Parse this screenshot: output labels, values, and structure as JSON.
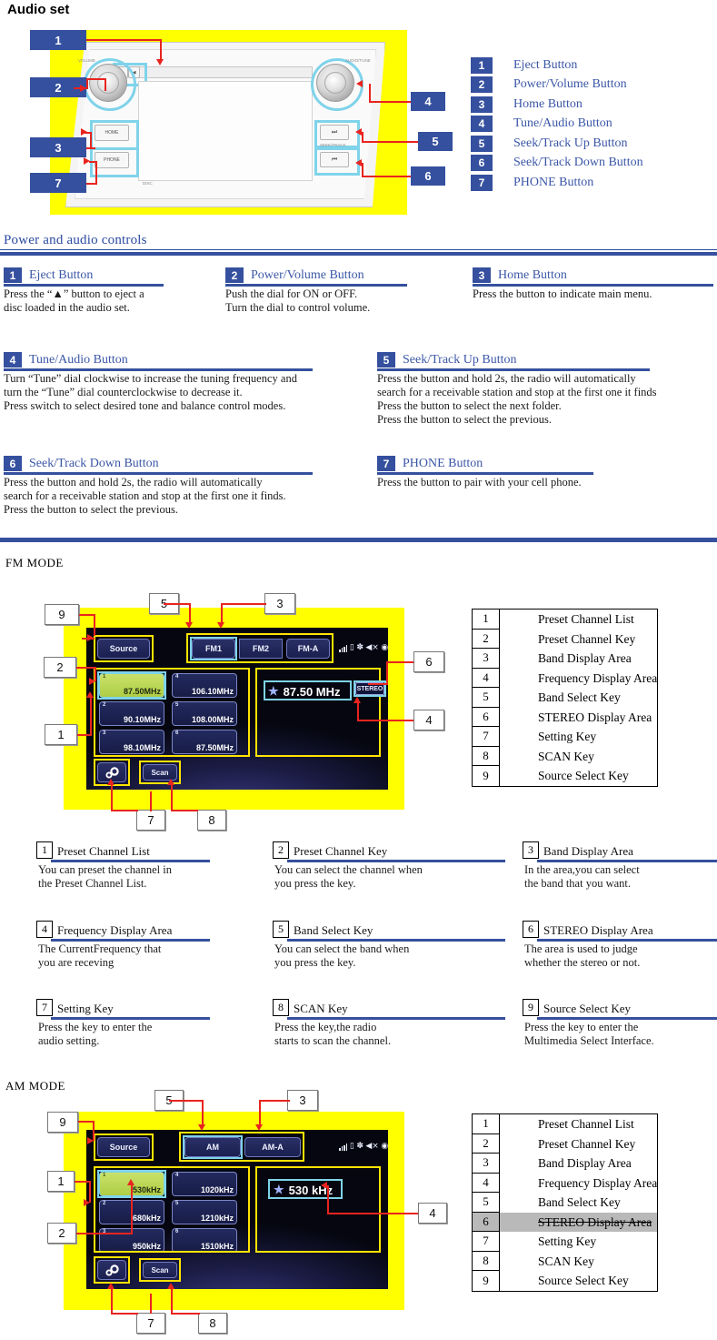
{
  "page_title": "Audio set",
  "head_unit": {
    "knob_left_label": "VOLUME",
    "knob_right_label": "AUDIO/TUNE",
    "key_home": "HOME",
    "key_phone": "PHONE",
    "key_seek_up": "⏭",
    "key_seek_down": "⏮",
    "seek_track_caption": "SEEK/TRACK",
    "disc_caption": "DISC",
    "eject_glyph": "▲",
    "disc_glyph": "◀",
    "callouts": [
      "1",
      "2",
      "3",
      "7",
      "4",
      "5",
      "6"
    ]
  },
  "top_legend": [
    {
      "num": "1",
      "label": "Eject Button"
    },
    {
      "num": "2",
      "label": "Power/Volume Button"
    },
    {
      "num": "3",
      "label": "Home Button"
    },
    {
      "num": "4",
      "label": "Tune/Audio Button"
    },
    {
      "num": "5",
      "label": "Seek/Track Up Button"
    },
    {
      "num": "6",
      "label": "Seek/Track Down Button"
    },
    {
      "num": "7",
      "label": "PHONE Button"
    }
  ],
  "controls_section": {
    "heading": "Power and audio controls",
    "topics": [
      {
        "num": "1",
        "name": "Eject Button",
        "lines": [
          "Press the “▲” button to eject a",
          "disc loaded in the audio set."
        ]
      },
      {
        "num": "2",
        "name": "Power/Volume Button",
        "lines": [
          "Push the dial for ON or OFF.",
          "Turn the dial to control volume."
        ]
      },
      {
        "num": "3",
        "name": "Home Button",
        "lines": [
          "Press the button to indicate main menu."
        ]
      },
      {
        "num": "4",
        "name": "Tune/Audio Button",
        "lines": [
          "Turn “Tune” dial clockwise to increase the tuning frequency and",
          "turn the “Tune” dial counterclockwise to decrease it.",
          "Press switch to select desired tone and balance control modes."
        ]
      },
      {
        "num": "5",
        "name": "Seek/Track Up Button",
        "lines": [
          "Press the button and hold 2s, the radio will automatically",
          "search for a receivable station and stop at the first one it finds",
          "Press the button to select the next folder.",
          "Press the button to select the previous."
        ]
      },
      {
        "num": "6",
        "name": "Seek/Track Down Button",
        "lines": [
          "Press the button and hold 2s, the radio will automatically",
          "search for a receivable station and stop at the first one it finds.",
          "Press the button to select the previous."
        ]
      },
      {
        "num": "7",
        "name": "PHONE Button",
        "lines": [
          "Press the button to pair with your cell phone."
        ]
      }
    ]
  },
  "fm_mode": {
    "label": "FM  MODE",
    "screen": {
      "source_button": "Source",
      "bands": [
        {
          "label": "FM1",
          "active": true
        },
        {
          "label": "FM2",
          "active": false
        },
        {
          "label": "FM-A",
          "active": false
        }
      ],
      "presets": [
        {
          "idx": "1",
          "freq": "87.50MHz",
          "selected": true
        },
        {
          "idx": "2",
          "freq": "90.10MHz",
          "selected": false
        },
        {
          "idx": "3",
          "freq": "98.10MHz",
          "selected": false
        },
        {
          "idx": "4",
          "freq": "106.10MHz",
          "selected": false
        },
        {
          "idx": "5",
          "freq": "108.00MHz",
          "selected": false
        },
        {
          "idx": "6",
          "freq": "87.50MHz",
          "selected": false
        }
      ],
      "current_frequency": "87.50 MHz",
      "stereo_tag": "STEREO",
      "scan_button": "Scan",
      "setting_icon": "gear-icon",
      "star_glyph": "★"
    },
    "callouts": [
      "9",
      "5",
      "3",
      "2",
      "1",
      "6",
      "4",
      "7",
      "8"
    ],
    "legend": [
      {
        "num": "1",
        "label": "Preset Channel List",
        "struck": false
      },
      {
        "num": "2",
        "label": "Preset Channel Key",
        "struck": false
      },
      {
        "num": "3",
        "label": "Band Display Area",
        "struck": false
      },
      {
        "num": "4",
        "label": "Frequency Display Area",
        "struck": false
      },
      {
        "num": "5",
        "label": "Band Select Key",
        "struck": false
      },
      {
        "num": "6",
        "label": "STEREO Display Area",
        "struck": false
      },
      {
        "num": "7",
        "label": "Setting Key",
        "struck": false
      },
      {
        "num": "8",
        "label": "SCAN Key",
        "struck": false
      },
      {
        "num": "9",
        "label": "Source Select Key",
        "struck": false
      }
    ],
    "topics": [
      {
        "num": "1",
        "name": "Preset Channel List",
        "lines": [
          "You can preset the channel in",
          "the Preset Channel List."
        ]
      },
      {
        "num": "2",
        "name": "Preset Channel Key",
        "lines": [
          "You can select the channel when",
          " you press the key."
        ]
      },
      {
        "num": "3",
        "name": "Band Display Area",
        "lines": [
          "In the area,you can select",
          "the band that you want."
        ]
      },
      {
        "num": "4",
        "name": "Frequency Display Area",
        "lines": [
          "The CurrentFrequency that",
          "you are receving"
        ]
      },
      {
        "num": "5",
        "name": "Band Select Key",
        "lines": [
          "You can select the band when",
          " you press the key."
        ]
      },
      {
        "num": "6",
        "name": "STEREO Display Area",
        "lines": [
          "The area is used to judge",
          "whether the stereo or not."
        ]
      },
      {
        "num": "7",
        "name": "Setting Key",
        "lines": [
          "Press the key to enter the",
          "audio setting."
        ]
      },
      {
        "num": "8",
        "name": "SCAN Key",
        "lines": [
          "Press the key,the radio",
          "starts to scan the channel."
        ]
      },
      {
        "num": "9",
        "name": "Source Select Key",
        "lines": [
          "Press the key to enter the",
          "Multimedia Select Interface."
        ]
      }
    ]
  },
  "am_mode": {
    "label": "AM MODE",
    "screen": {
      "source_button": "Source",
      "bands": [
        {
          "label": "AM",
          "active": true
        },
        {
          "label": "AM-A",
          "active": false
        }
      ],
      "presets": [
        {
          "idx": "1",
          "freq": "530kHz",
          "selected": true
        },
        {
          "idx": "2",
          "freq": "680kHz",
          "selected": false
        },
        {
          "idx": "3",
          "freq": "950kHz",
          "selected": false
        },
        {
          "idx": "4",
          "freq": "1020kHz",
          "selected": false
        },
        {
          "idx": "5",
          "freq": "1210kHz",
          "selected": false
        },
        {
          "idx": "6",
          "freq": "1510kHz",
          "selected": false
        }
      ],
      "current_frequency": "530 kHz",
      "scan_button": "Scan",
      "setting_icon": "gear-icon",
      "star_glyph": "★"
    },
    "callouts": [
      "9",
      "5",
      "3",
      "1",
      "2",
      "4",
      "7",
      "8"
    ],
    "legend": [
      {
        "num": "1",
        "label": "Preset Channel List",
        "struck": false
      },
      {
        "num": "2",
        "label": "Preset Channel Key",
        "struck": false
      },
      {
        "num": "3",
        "label": "Band Display Area",
        "struck": false
      },
      {
        "num": "4",
        "label": "Frequency Display Area",
        "struck": false
      },
      {
        "num": "5",
        "label": "Band Select Key",
        "struck": false
      },
      {
        "num": "6",
        "label": "STEREO Display Area",
        "struck": true
      },
      {
        "num": "7",
        "label": "Setting Key",
        "struck": false
      },
      {
        "num": "8",
        "label": "SCAN Key",
        "struck": false
      },
      {
        "num": "9",
        "label": "Source Select Key",
        "struck": false
      }
    ]
  },
  "colors": {
    "accent_blue": "#35509e",
    "link_blue": "#3b57a7",
    "highlight_yellow": "#ffff00",
    "callout_red": "#e8241f",
    "cyan_highlight": "#7fd3ea",
    "green_active": "#aecd45",
    "struck_gray": "#b9b9b9"
  }
}
